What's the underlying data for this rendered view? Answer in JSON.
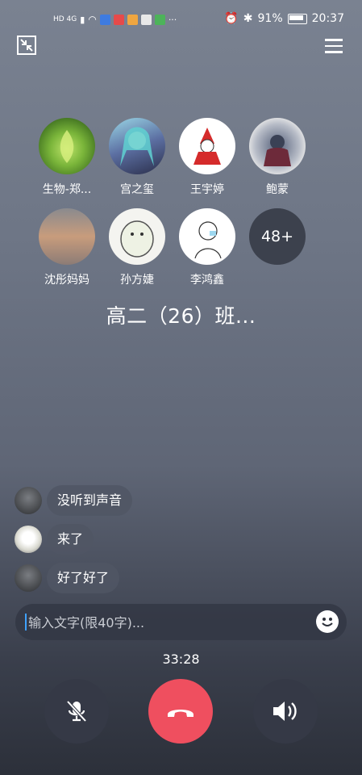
{
  "statusbar": {
    "left": "HD 4G",
    "battery": "91%",
    "time": "20:37",
    "more": "···"
  },
  "top": {
    "minimize_icon": "minimize-icon",
    "menu_icon": "menu-icon"
  },
  "members": [
    {
      "name": "生物-郑...",
      "avatar": "lotus"
    },
    {
      "name": "宫之玺",
      "avatar": "anime"
    },
    {
      "name": "王宇婷",
      "avatar": "red-figure"
    },
    {
      "name": "鲍蒙",
      "avatar": "splash"
    },
    {
      "name": "沈彤妈妈",
      "avatar": "clouds"
    },
    {
      "name": "孙方婕",
      "avatar": "hamster"
    },
    {
      "name": "李鸿鑫",
      "avatar": "sketch"
    }
  ],
  "more_count": "48+",
  "group_title": "高二（26）班...",
  "messages": [
    {
      "text": "没听到声音"
    },
    {
      "text": "来了"
    },
    {
      "text": "好了好了"
    }
  ],
  "input": {
    "placeholder": "输入文字(限40字)..."
  },
  "timer": "33:28",
  "colors": {
    "hangup": "#ef4f5f",
    "control": "#353946",
    "caret": "#3fa1ff"
  }
}
